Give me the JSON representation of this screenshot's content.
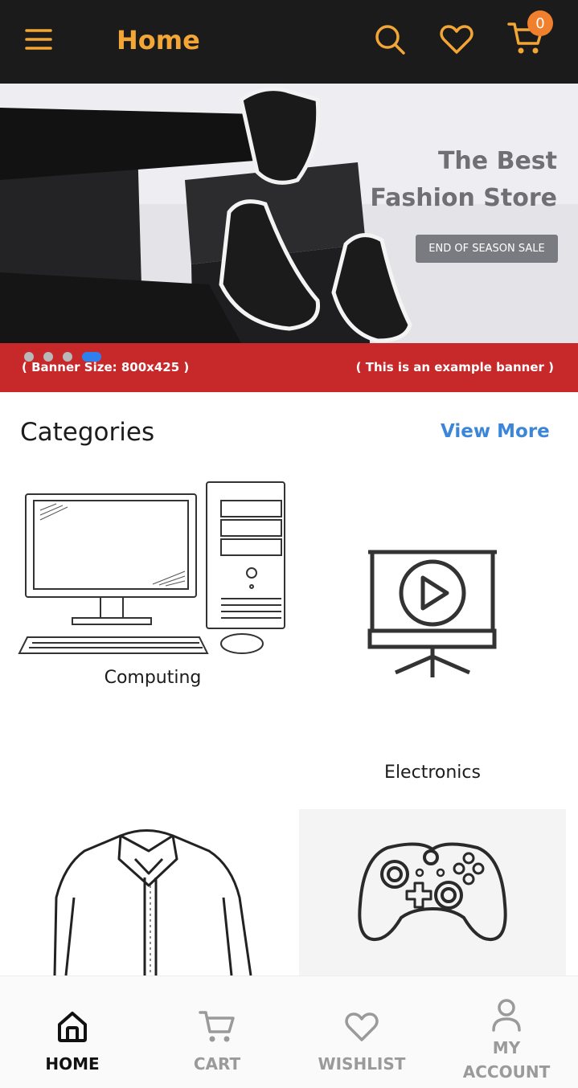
{
  "header": {
    "title": "Home",
    "cart_count": "0",
    "icons": {
      "menu": "menu-icon",
      "search": "search-icon",
      "wishlist": "heart-icon",
      "cart": "cart-icon"
    },
    "accent_color": "#f3a536",
    "badge_color": "#f07f2e",
    "background": "#1b1b1b"
  },
  "banner": {
    "heading_line1": "The Best",
    "heading_line2": "Fashion Store",
    "cta": "END OF SEASON SALE",
    "note_left": "( Banner Size: 800x425 )",
    "note_right": "( This is an example banner )",
    "slide_count": 4,
    "active_slide": 4,
    "strip_color": "#c7292a"
  },
  "categories": {
    "title": "Categories",
    "view_more": "View More",
    "items": [
      {
        "label": "Computing",
        "icon": "computer-icon"
      },
      {
        "label": "Electronics",
        "icon": "presentation-play-icon"
      },
      {
        "label": "",
        "icon": "shirt-icon"
      },
      {
        "label": "",
        "icon": "gamepad-icon"
      }
    ]
  },
  "bottom_nav": {
    "items": [
      {
        "label": "HOME",
        "icon": "home-icon",
        "active": true
      },
      {
        "label": "CART",
        "icon": "cart-icon",
        "active": false
      },
      {
        "label": "WISHLIST",
        "icon": "heart-icon",
        "active": false
      },
      {
        "label": "MY ACCOUNT",
        "icon": "user-icon",
        "active": false
      }
    ]
  }
}
